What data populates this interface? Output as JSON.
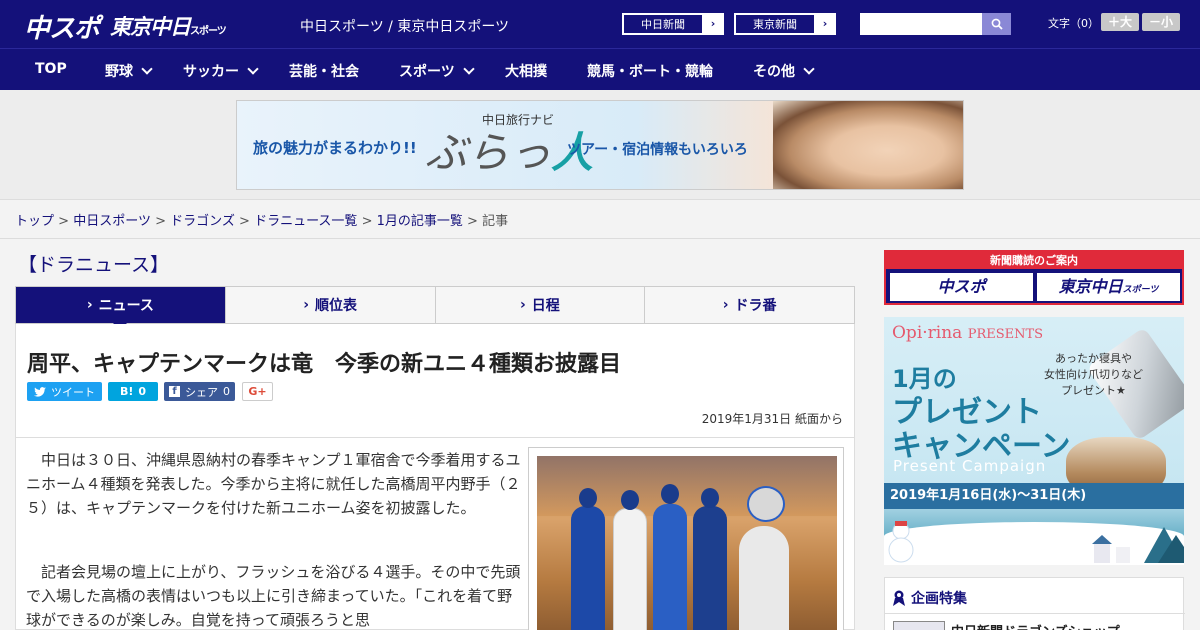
{
  "header": {
    "logo_chuspo": "中スポ",
    "logo_tokyo": "東京中日",
    "logo_tokyo_small": "スポーツ",
    "site_name": "中日スポーツ / 東京中日スポーツ",
    "ext_links": [
      {
        "label": "中日新聞",
        "arrow": "›"
      },
      {
        "label": "東京新聞",
        "arrow": "›"
      }
    ],
    "search_placeholder": "",
    "fontsize_label": "文字（0）",
    "font_up": "＋大",
    "font_down": "－小"
  },
  "nav": {
    "items": [
      {
        "label": "TOP"
      },
      {
        "label": "野球"
      },
      {
        "label": "サッカー"
      },
      {
        "label": "芸能・社会"
      },
      {
        "label": "スポーツ"
      },
      {
        "label": "大相撲"
      },
      {
        "label": "競馬・ボート・競輪"
      },
      {
        "label": "その他"
      }
    ]
  },
  "ad_banner": {
    "left_text": "旅の魅力がまるわかり!!",
    "navi_label": "中日旅行ナビ",
    "logo_text": "ぶらっ",
    "logo_text_accent": "人",
    "right_text": "ツアー・宿泊情報もいろいろ"
  },
  "breadcrumb": {
    "items": [
      "トップ",
      "中日スポーツ",
      "ドラゴンズ",
      "ドラニュース一覧",
      "1月の記事一覧"
    ],
    "current": "記事",
    "separator": ">"
  },
  "section": {
    "title": "【ドラニュース】"
  },
  "tabs": [
    {
      "label": "ニュース",
      "active": true
    },
    {
      "label": "順位表",
      "active": false
    },
    {
      "label": "日程",
      "active": false
    },
    {
      "label": "ドラ番",
      "active": false
    }
  ],
  "article": {
    "headline": "周平、キャプテンマークは竜　今季の新ユニ４種類お披露目",
    "share": {
      "tweet": "ツイート",
      "hatena": "B!",
      "hatena_count": "0",
      "fb": "シェア",
      "fb_count": "0",
      "gplus": "G+"
    },
    "dateline": "2019年1月31日 紙面から",
    "paragraphs": [
      "　中日は３０日、沖縄県恩納村の春季キャンプ１軍宿舎で今季着用するユニホーム４種類を発表した。今季から主将に就任した高橋周平内野手（２５）は、キャプテンマークを付けた新ユニホーム姿を初披露した。",
      "　記者会見場の壇上に上がり、フラッシュを浴びる４選手。その中で先頭で入場した高橋の表情はいつも以上に引き締まっていた。「これを着て野球ができるのが楽しみ。自覚を持って頑張ろうと思"
    ]
  },
  "sidebar": {
    "subscribe_head": "新聞購読のご案内",
    "subscribe_chuspo": "中スポ",
    "subscribe_tokyo": "東京中日",
    "subscribe_tokyo_small": "スポーツ",
    "promo": {
      "brand": "Opi·rina",
      "brand_suffix": "PRESENTS",
      "copy": [
        "あったか寝具や",
        "女性向け爪切りなど",
        "プレゼント★"
      ],
      "title_line1": "1月の",
      "title_line2": "プレゼント",
      "title_line3": "キャンペーン",
      "subtitle": "Present Campaign",
      "date": "2019年1月16日(水)〜31日(木)"
    },
    "kikaku_title": "企画特集",
    "kikaku_item": "中日新聞ドラゴンズショップ"
  }
}
